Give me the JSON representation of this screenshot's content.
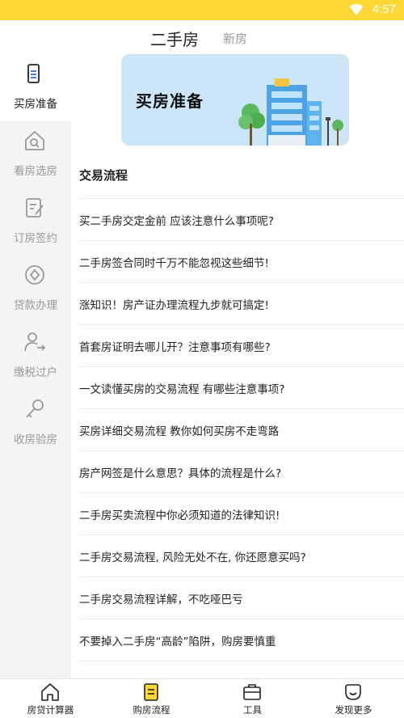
{
  "status_bar": {
    "time": "4:57"
  },
  "header": {
    "active_tab": "二手房",
    "other_tab": "新房"
  },
  "sidebar": {
    "items": [
      {
        "label": "买房准备",
        "icon": "phone-doc-icon",
        "active": true
      },
      {
        "label": "看房选房",
        "icon": "house-search-icon",
        "active": false
      },
      {
        "label": "订房签约",
        "icon": "contract-edit-icon",
        "active": false
      },
      {
        "label": "贷款办理",
        "icon": "loan-diamond-icon",
        "active": false
      },
      {
        "label": "缴税过户",
        "icon": "person-transfer-icon",
        "active": false
      },
      {
        "label": "收房验房",
        "icon": "key-icon",
        "active": false
      }
    ]
  },
  "banner": {
    "title": "买房准备"
  },
  "main": {
    "section_title": "交易流程",
    "articles": [
      "买二手房交定金前 应该注意什么事项呢?",
      "二手房签合同时千万不能忽视这些细节!",
      "涨知识！房产证办理流程九步就可搞定!",
      "首套房证明去哪儿开？注意事项有哪些?",
      "一文读懂买房的交易流程 有哪些注意事项?",
      "买房详细交易流程 教你如何买房不走弯路",
      "房产网签是什么意思？具体的流程是什么?",
      "二手房买卖流程中你必须知道的法律知识!",
      "二手房交易流程, 风险无处不在, 你还愿意买吗?",
      "二手房交易流程详解，不吃哑巴亏",
      "不要掉入二手房“高龄”陷阱，购房要慎重"
    ]
  },
  "bottom_nav": [
    {
      "label": "房贷计算器",
      "icon": "home-icon"
    },
    {
      "label": "购房流程",
      "icon": "list-doc-icon"
    },
    {
      "label": "工具",
      "icon": "toolbox-icon"
    },
    {
      "label": "发现更多",
      "icon": "discover-icon"
    }
  ],
  "colors": {
    "accent": "#fdd835",
    "sidebar_bg": "#f4f4f4",
    "banner_bg": "#cde6f7"
  }
}
